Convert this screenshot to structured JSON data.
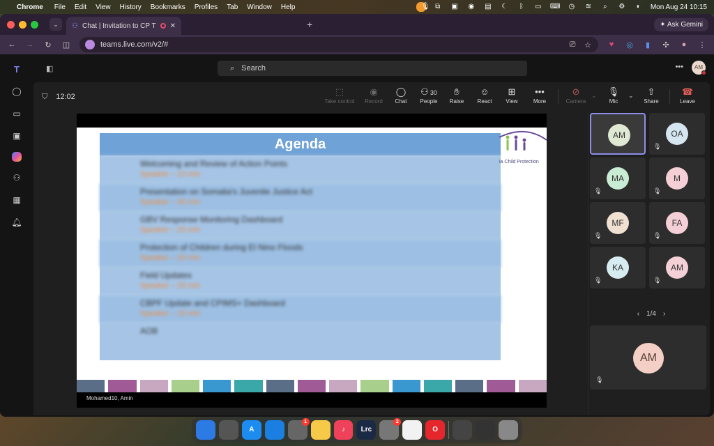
{
  "menubar": {
    "app": "Chrome",
    "items": [
      "File",
      "Edit",
      "View",
      "History",
      "Bookmarks",
      "Profiles",
      "Tab",
      "Window",
      "Help"
    ],
    "datetime": "Mon Aug 24  10:15"
  },
  "browser": {
    "tab_title": "Chat | Invitation to CP TW",
    "ask_gemini": "Ask Gemini",
    "url": "teams.live.com/v2/#"
  },
  "teams": {
    "search_placeholder": "Search",
    "avatar_initials": "AM",
    "meeting": {
      "timer": "12:02",
      "controls": {
        "take_control": "Take control",
        "record": "Record",
        "chat": "Chat",
        "people": "People",
        "people_count": "30",
        "raise": "Raise",
        "react": "React",
        "view": "View",
        "more": "More",
        "camera": "Camera",
        "mic": "Mic",
        "share": "Share",
        "leave": "Leave"
      },
      "slide": {
        "title": "Agenda",
        "logo_text": "ia Child Protection",
        "rows": [
          {
            "main": "Welcoming and Review of Action Points",
            "sub": "Speaker – 10 min"
          },
          {
            "main": "Presentation on Somalia's Juvenile Justice Act",
            "sub": "Speaker – 30 min"
          },
          {
            "main": "GBV Response Monitoring Dashboard",
            "sub": "Speaker – 20 min"
          },
          {
            "main": "Protection of Children during El Nino Floods",
            "sub": "Speaker – 20 min"
          },
          {
            "main": "Field Updates",
            "sub": "Speaker – 20 min"
          },
          {
            "main": "CBPF Update and CPIMS+ Dashboard",
            "sub": "Speaker – 15 min"
          },
          {
            "main": "AOB",
            "sub": ""
          }
        ],
        "strip_colors": [
          "#5a6e88",
          "#a05a96",
          "#c8a8c0",
          "#a8d08c",
          "#3a98d0",
          "#3aa8a8",
          "#5a6e88",
          "#a05a96",
          "#c8a8c0",
          "#a8d08c",
          "#3a98d0",
          "#3aa8a8",
          "#5a6e88",
          "#a05a96",
          "#c8a8c0"
        ]
      },
      "presenter": "Mohamed10, Amin",
      "participants": [
        {
          "initials": "AM",
          "color": "#dfe8d2",
          "speaking": true,
          "muted": false
        },
        {
          "initials": "OA",
          "color": "#d6e6f0",
          "speaking": false,
          "muted": true
        },
        {
          "initials": "MA",
          "color": "#c9ecd4",
          "speaking": false,
          "muted": true
        },
        {
          "initials": "M",
          "color": "#f4cfd6",
          "speaking": false,
          "muted": true
        },
        {
          "initials": "MF",
          "color": "#f0e0d2",
          "speaking": false,
          "muted": true
        },
        {
          "initials": "FA",
          "color": "#f4cfd6",
          "speaking": false,
          "muted": true
        },
        {
          "initials": "KA",
          "color": "#d6ecf0",
          "speaking": false,
          "muted": true
        },
        {
          "initials": "AM",
          "color": "#f4cfd6",
          "speaking": false,
          "muted": true
        }
      ],
      "pager": "1/4",
      "self_initials": "AM"
    }
  },
  "dock": {
    "apps": [
      {
        "name": "finder",
        "color": "#2c7be5",
        "label": ""
      },
      {
        "name": "launchpad",
        "color": "#555",
        "label": ""
      },
      {
        "name": "app-store",
        "color": "#1c8cf0",
        "label": "A"
      },
      {
        "name": "safari",
        "color": "#1a7fe0",
        "label": ""
      },
      {
        "name": "reminders",
        "color": "#666",
        "label": "",
        "badge": "1"
      },
      {
        "name": "notes",
        "color": "#f7c948",
        "label": ""
      },
      {
        "name": "music",
        "color": "#f0415a",
        "label": "♪"
      },
      {
        "name": "lightroom",
        "color": "#1b2a44",
        "label": "Lrc"
      },
      {
        "name": "system-settings",
        "color": "#777",
        "label": "",
        "badge": "2"
      },
      {
        "name": "chrome",
        "color": "#f2f2f2",
        "label": ""
      },
      {
        "name": "opera",
        "color": "#e5262c",
        "label": "O"
      },
      {
        "name": "window-preview-1",
        "color": "#444",
        "label": ""
      },
      {
        "name": "window-preview-2",
        "color": "#333",
        "label": ""
      },
      {
        "name": "trash",
        "color": "#888",
        "label": ""
      }
    ]
  }
}
